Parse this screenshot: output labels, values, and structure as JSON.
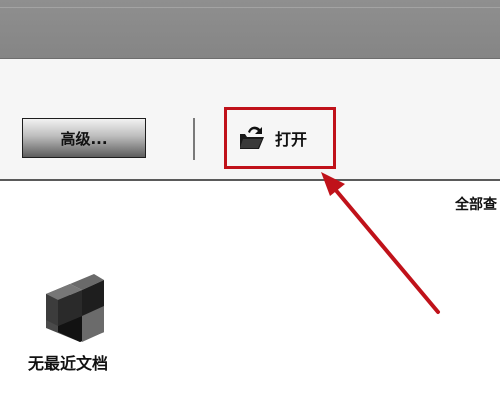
{
  "toolbar": {
    "advanced_label": "高级...",
    "open_label": "打开",
    "view_all_label": "全部查"
  },
  "recent": {
    "empty_label": "无最近文档"
  },
  "annotation": {
    "color": "#c0121a"
  },
  "icons": {
    "open": "open-folder-icon",
    "document": "document-3d-icon"
  }
}
